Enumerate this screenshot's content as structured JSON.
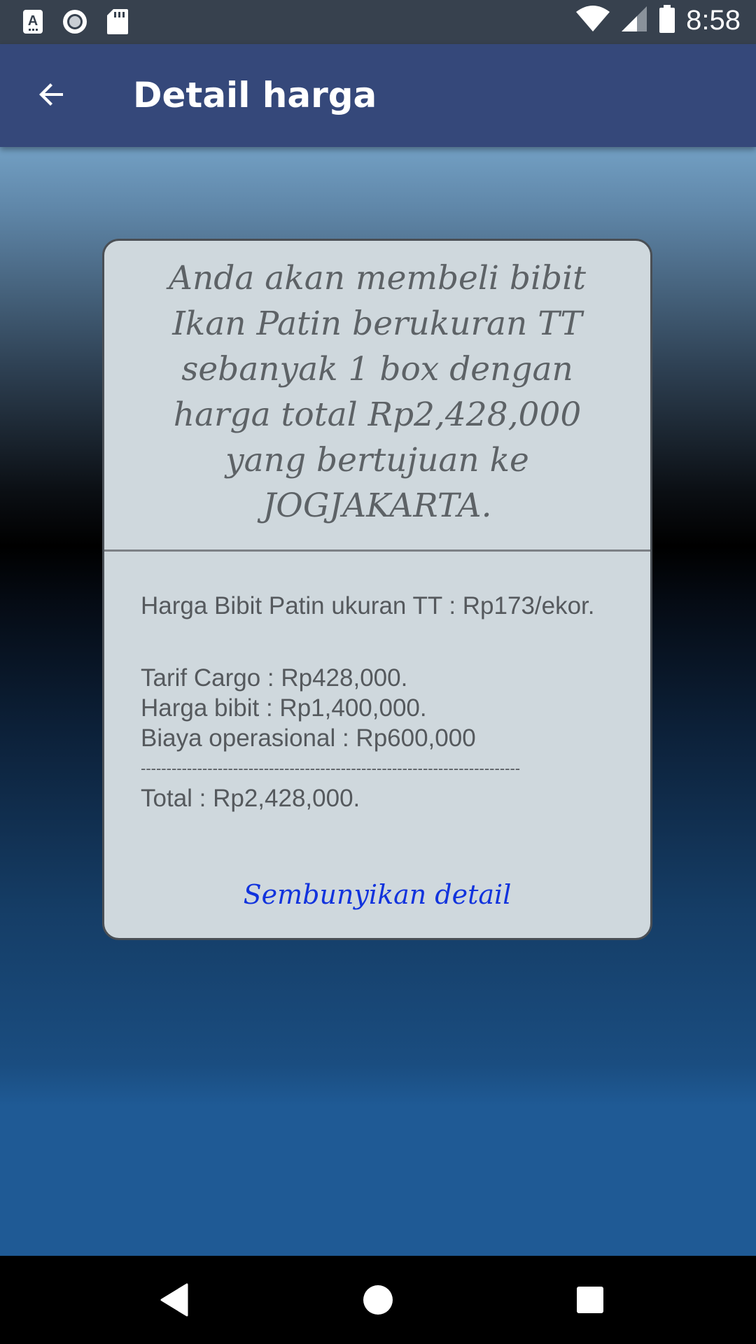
{
  "status_bar": {
    "time": "8:58",
    "icons": [
      "text-a-icon",
      "record-icon",
      "sd-card-icon",
      "wifi-icon",
      "signal-icon",
      "battery-icon"
    ]
  },
  "app_bar": {
    "title": "Detail harga",
    "back_icon": "arrow-back-icon"
  },
  "card": {
    "summary": "Anda akan membeli bibit Ikan Patin berukuran TT sebanyak 1 box dengan harga total Rp2,428,000 yang bertujuan ke JOGJAKARTA.",
    "price_per_unit": "Harga Bibit Patin ukuran TT : Rp173/ekor.",
    "cargo_fee": "Tarif Cargo : Rp428,000.",
    "seed_price": "Harga bibit : Rp1,400,000.",
    "operational_cost": "Biaya operasional : Rp600,000",
    "separator": "--------------------------------------------------------------------------",
    "total": "Total : Rp2,428,000.",
    "hide_detail_label": "Sembunyikan detail"
  },
  "colors": {
    "app_bar": "#35487a",
    "status_bar": "#37414e",
    "card_bg": "#cfd8dd",
    "link": "#1133dd"
  },
  "nav_bar": {
    "icons": [
      "back-triangle-icon",
      "home-circle-icon",
      "recents-square-icon"
    ]
  }
}
